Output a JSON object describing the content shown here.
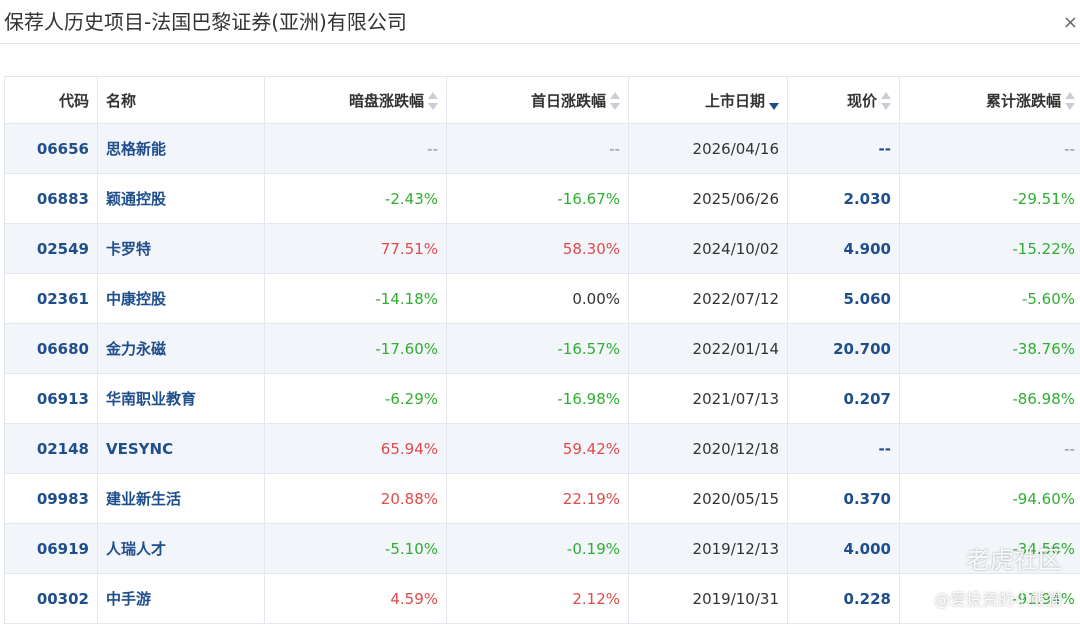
{
  "window": {
    "title": "保荐人历史项目-法国巴黎证券(亚洲)有限公司",
    "close_icon": "close-icon"
  },
  "table": {
    "headers": {
      "code": "代码",
      "name": "名称",
      "dark": "暗盘涨跌幅",
      "first_day": "首日涨跌幅",
      "list_date": "上市日期",
      "price": "现价",
      "cumulative": "累计涨跌幅"
    },
    "sorted_column": "list_date",
    "sort_direction": "desc",
    "rows": [
      {
        "code": "06656",
        "name": "思格新能",
        "dark": "--",
        "first_day": "--",
        "list_date": "2026/04/16",
        "price": "--",
        "cumulative": "--"
      },
      {
        "code": "06883",
        "name": "颖通控股",
        "dark": "-2.43%",
        "first_day": "-16.67%",
        "list_date": "2025/06/26",
        "price": "2.030",
        "cumulative": "-29.51%"
      },
      {
        "code": "02549",
        "name": "卡罗特",
        "dark": "77.51%",
        "first_day": "58.30%",
        "list_date": "2024/10/02",
        "price": "4.900",
        "cumulative": "-15.22%"
      },
      {
        "code": "02361",
        "name": "中康控股",
        "dark": "-14.18%",
        "first_day": "0.00%",
        "list_date": "2022/07/12",
        "price": "5.060",
        "cumulative": "-5.60%"
      },
      {
        "code": "06680",
        "name": "金力永磁",
        "dark": "-17.60%",
        "first_day": "-16.57%",
        "list_date": "2022/01/14",
        "price": "20.700",
        "cumulative": "-38.76%"
      },
      {
        "code": "06913",
        "name": "华南职业教育",
        "dark": "-6.29%",
        "first_day": "-16.98%",
        "list_date": "2021/07/13",
        "price": "0.207",
        "cumulative": "-86.98%"
      },
      {
        "code": "02148",
        "name": "VESYNC",
        "dark": "65.94%",
        "first_day": "59.42%",
        "list_date": "2020/12/18",
        "price": "--",
        "cumulative": "--"
      },
      {
        "code": "09983",
        "name": "建业新生活",
        "dark": "20.88%",
        "first_day": "22.19%",
        "list_date": "2020/05/15",
        "price": "0.370",
        "cumulative": "-94.60%"
      },
      {
        "code": "06919",
        "name": "人瑞人才",
        "dark": "-5.10%",
        "first_day": "-0.19%",
        "list_date": "2019/12/13",
        "price": "4.000",
        "cumulative": "-34.56%"
      },
      {
        "code": "00302",
        "name": "中手游",
        "dark": "4.59%",
        "first_day": "2.12%",
        "list_date": "2019/10/31",
        "price": "0.228",
        "cumulative": "-91.94%"
      }
    ]
  },
  "colors": {
    "up": "#e04a4a",
    "down": "#2fae2f",
    "link": "#1f4e8c",
    "stripe": "#f2f6fb"
  },
  "watermark": {
    "logo": "老虎社区",
    "user": "@爱投资的小熊猫"
  }
}
